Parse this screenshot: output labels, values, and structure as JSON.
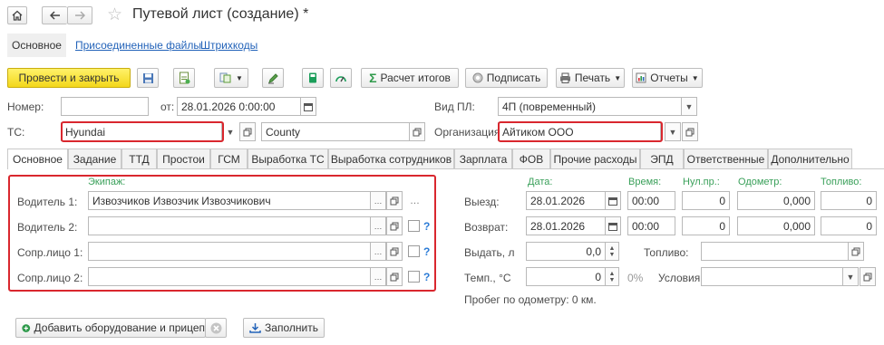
{
  "window": {
    "title": "Путевой лист (создание) *"
  },
  "nav_tabs": [
    {
      "label": "Основное"
    },
    {
      "label": "Присоединенные файлы"
    },
    {
      "label": "Штрихкоды"
    }
  ],
  "toolbar": {
    "post_close": "Провести и закрыть",
    "calc_totals": "Расчет итогов",
    "sign": "Подписать",
    "print": "Печать",
    "reports": "Отчеты"
  },
  "header": {
    "number_label": "Номер:",
    "number_value": "",
    "date_label": "от:",
    "date_value": "28.01.2026  0:00:00",
    "type_label": "Вид ПЛ:",
    "type_value": "4П (повременный)",
    "vehicle_label": "ТС:",
    "vehicle_value": "Hyundai",
    "model_value": "County",
    "org_label": "Организация:",
    "org_value": "Айтиком ООО"
  },
  "tabs": [
    {
      "label": "Основное"
    },
    {
      "label": "Задание"
    },
    {
      "label": "ТТД"
    },
    {
      "label": "Простои"
    },
    {
      "label": "ГСМ"
    },
    {
      "label": "Выработка ТС"
    },
    {
      "label": "Выработка сотрудников"
    },
    {
      "label": "Зарплата"
    },
    {
      "label": "ФОВ"
    },
    {
      "label": "Прочие расходы"
    },
    {
      "label": "ЭПД"
    },
    {
      "label": "Ответственные"
    },
    {
      "label": "Дополнительно"
    }
  ],
  "crew": {
    "header": "Экипаж:",
    "rows": [
      {
        "label": "Водитель 1:",
        "value": "Извозчиков Извозчик Извозчикович"
      },
      {
        "label": "Водитель 2:",
        "value": ""
      },
      {
        "label": "Сопр.лицо 1:",
        "value": ""
      },
      {
        "label": "Сопр.лицо 2:",
        "value": ""
      }
    ]
  },
  "trip": {
    "col_date": "Дата:",
    "col_time": "Время:",
    "col_zero": "Нул.пр.:",
    "col_odometer": "Одометр:",
    "col_fuel": "Топливо:",
    "departure_label": "Выезд:",
    "departure_date": "28.01.2026",
    "departure_time": "00:00",
    "departure_zero": "0",
    "departure_odometer": "0,000",
    "departure_fuel": "0",
    "return_label": "Возврат:",
    "return_date": "28.01.2026",
    "return_time": "00:00",
    "return_zero": "0",
    "return_odometer": "0,000",
    "return_fuel": "0",
    "issue_label": "Выдать, л",
    "issue_value": "0,0",
    "fuel_label": "Топливо:",
    "temp_label": "Темп., °C",
    "temp_value": "0",
    "temp_pct": "0%",
    "conditions_label": "Условия:",
    "mileage_text": "Пробег по одометру: 0 км."
  },
  "footer": {
    "add_equipment": "Добавить оборудование и прицеп",
    "fill": "Заполнить"
  },
  "colors": {
    "accent_yellow": "#f3d71b",
    "highlight_red": "#d9272e",
    "header_green": "#3aa05a"
  }
}
